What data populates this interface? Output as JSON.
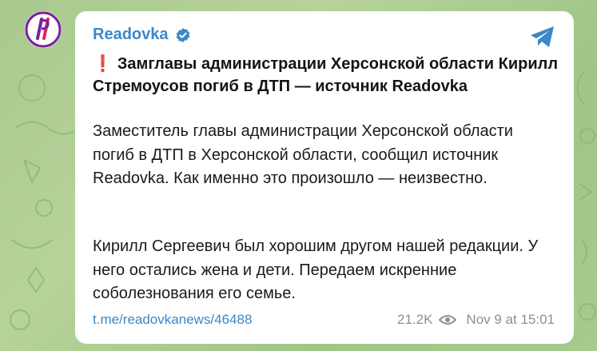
{
  "post": {
    "channel_name": "Readovka",
    "headline_mark": "❗",
    "headline": "Замглавы администрации Херсонской области Кирилл Стремоусов погиб в ДТП — источник Readovka",
    "paragraph1": "Заместитель главы администрации Херсонской области погиб в ДТП в Херсонской области, сообщил источник Readovka. Как именно это произошло — неизвестно.",
    "paragraph2": "Кирилл Сергеевич был хорошим другом нашей редакции. У него остались жена и дети. Передаем искренние соболезнования его семье.",
    "link": "t.me/readovkanews/46488",
    "views": "21.2K",
    "timestamp": "Nov 9 at 15:01"
  },
  "icons": {
    "avatar": "readovka-logo-icon",
    "verified": "verified-badge-icon",
    "share": "telegram-share-icon",
    "views": "eye-icon"
  },
  "colors": {
    "accent": "#3a88c8",
    "exclamation": "#e02424",
    "background": "#a9c98e",
    "logo_purple": "#7a1fa2",
    "logo_red": "#e0245e"
  }
}
